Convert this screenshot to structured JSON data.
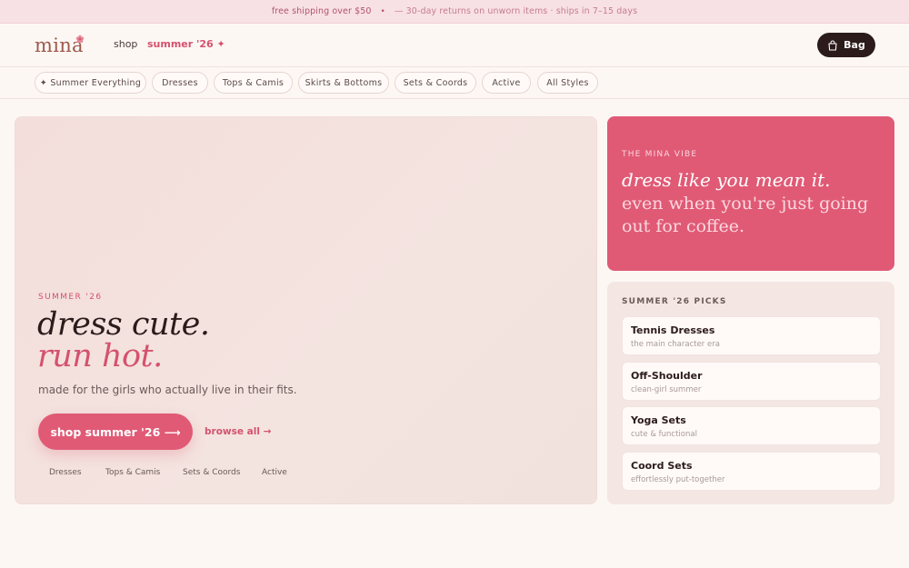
{
  "promo": {
    "shipping": "free shipping over $50",
    "separator": "•",
    "returns": "— 30-day returns on unworn items · ships in 7–15 days"
  },
  "header": {
    "logo": "mina",
    "nav": [
      {
        "label": "shop"
      },
      {
        "label": "summer '26 ✦"
      }
    ],
    "bag_label": "Bag"
  },
  "categories": [
    {
      "label": "✦ Summer Everything"
    },
    {
      "label": "Dresses"
    },
    {
      "label": "Tops & Camis"
    },
    {
      "label": "Skirts & Bottoms"
    },
    {
      "label": "Sets & Coords"
    },
    {
      "label": "Active"
    },
    {
      "label": "All Styles"
    }
  ],
  "hero": {
    "eyebrow": "SUMMER '26",
    "headline_line1": "dress cute.",
    "headline_line2": "run hot.",
    "subtitle": "made for the girls who actually live in their fits.",
    "cta": "shop summer '26 ⟶",
    "browse": "browse all →",
    "quick_links": [
      "Dresses",
      "Tops & Camis",
      "Sets & Coords",
      "Active"
    ]
  },
  "vibe": {
    "eyebrow": "THE MINA VIBE",
    "quote_italic": "dress like you mean it.",
    "quote_rest": "even when you're just going out for coffee."
  },
  "picks": {
    "title": "SUMMER '26 PICKS",
    "items": [
      {
        "title": "Tennis Dresses",
        "subtitle": "the main character era"
      },
      {
        "title": "Off-Shoulder",
        "subtitle": "clean-girl summer"
      },
      {
        "title": "Yoga Sets",
        "subtitle": "cute & functional"
      },
      {
        "title": "Coord Sets",
        "subtitle": "effortlessly put-together"
      }
    ]
  },
  "colors": {
    "accent": "#e05a75",
    "accent_text": "#d4526e",
    "dark": "#2b1b1b",
    "background": "#fdf7f4",
    "promo_bg": "#f8e1e5"
  },
  "icons": {
    "bag": "shopping-bag-icon",
    "logo_mark": "flower-icon"
  }
}
